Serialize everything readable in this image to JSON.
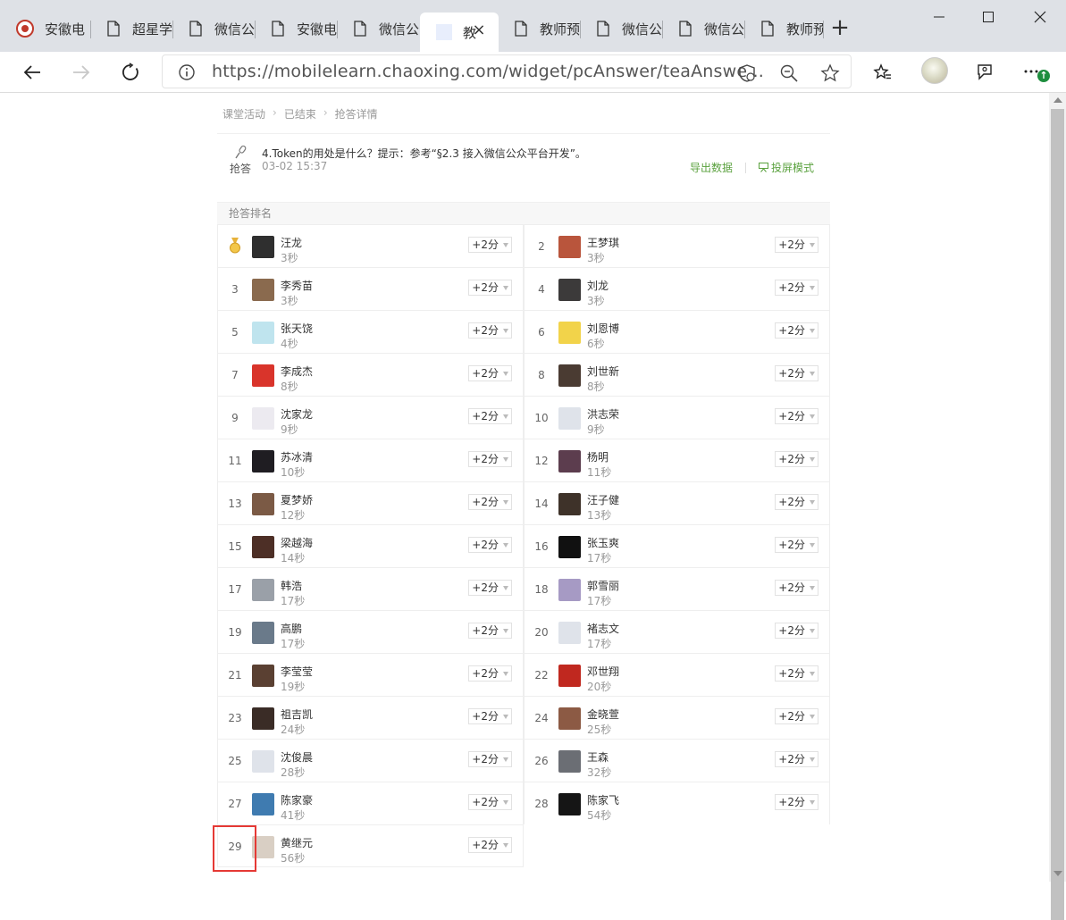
{
  "browser": {
    "tabs": [
      {
        "title": "安徽电",
        "icon": "seal-icon",
        "left": 0
      },
      {
        "title": "超星学",
        "icon": "page-icon"
      },
      {
        "title": "微信公",
        "icon": "page-icon"
      },
      {
        "title": "安徽电",
        "icon": "page-icon"
      },
      {
        "title": "微信公",
        "icon": "page-icon"
      },
      {
        "title": "教",
        "icon": "blank-icon",
        "active": true
      },
      {
        "title": "教师预",
        "icon": "page-icon"
      },
      {
        "title": "微信公",
        "icon": "page-icon"
      },
      {
        "title": "微信公",
        "icon": "page-icon"
      },
      {
        "title": "教师预",
        "icon": "page-icon"
      }
    ],
    "url": "https://mobilelearn.chaoxing.com/widget/pcAnswer/teaAnswe..."
  },
  "breadcrumb": [
    "课堂活动",
    "已结束",
    "抢答详情"
  ],
  "question": {
    "type_label": "抢答",
    "title": "4.Token的用处是什么？提示：参考“§2.3 接入微信公众平台开发”。",
    "time": "03-02 15:37",
    "export_label": "导出数据",
    "projector_label": "投屏模式"
  },
  "ranking": {
    "header": "抢答排名",
    "score_label": "+2分",
    "rows": [
      {
        "rank": "1",
        "name": "汪龙",
        "time": "3秒",
        "avatar": "#2f2f2f"
      },
      {
        "rank": "2",
        "name": "王梦琪",
        "time": "3秒",
        "avatar": "#b9553c"
      },
      {
        "rank": "3",
        "name": "李秀苗",
        "time": "3秒",
        "avatar": "#8a6a4e"
      },
      {
        "rank": "4",
        "name": "刘龙",
        "time": "3秒",
        "avatar": "#3c3a3a"
      },
      {
        "rank": "5",
        "name": "张天饶",
        "time": "4秒",
        "avatar": "#bfe4ee"
      },
      {
        "rank": "6",
        "name": "刘恩博",
        "time": "6秒",
        "avatar": "#f2d34a"
      },
      {
        "rank": "7",
        "name": "李成杰",
        "time": "8秒",
        "avatar": "#d9342b"
      },
      {
        "rank": "8",
        "name": "刘世新",
        "time": "8秒",
        "avatar": "#4a3b32"
      },
      {
        "rank": "9",
        "name": "沈家龙",
        "time": "9秒",
        "avatar": "#eceaf0"
      },
      {
        "rank": "10",
        "name": "洪志荣",
        "time": "9秒",
        "avatar": "#dfe3ea"
      },
      {
        "rank": "11",
        "name": "苏冰清",
        "time": "10秒",
        "avatar": "#1f1d22"
      },
      {
        "rank": "12",
        "name": "杨明",
        "time": "11秒",
        "avatar": "#5c3d4e"
      },
      {
        "rank": "13",
        "name": "夏梦娇",
        "time": "12秒",
        "avatar": "#7b5a45"
      },
      {
        "rank": "14",
        "name": "汪子健",
        "time": "13秒",
        "avatar": "#3e3229"
      },
      {
        "rank": "15",
        "name": "梁越海",
        "time": "14秒",
        "avatar": "#4d2f26"
      },
      {
        "rank": "16",
        "name": "张玉爽",
        "time": "17秒",
        "avatar": "#111111"
      },
      {
        "rank": "17",
        "name": "韩浩",
        "time": "17秒",
        "avatar": "#9aa0a8"
      },
      {
        "rank": "18",
        "name": "郭雪丽",
        "time": "17秒",
        "avatar": "#a69ac4"
      },
      {
        "rank": "19",
        "name": "高鹏",
        "time": "17秒",
        "avatar": "#6a7a8a"
      },
      {
        "rank": "20",
        "name": "褚志文",
        "time": "17秒",
        "avatar": "#dfe3ea"
      },
      {
        "rank": "21",
        "name": "李莹莹",
        "time": "19秒",
        "avatar": "#5a4032"
      },
      {
        "rank": "22",
        "name": "邓世翔",
        "time": "20秒",
        "avatar": "#c0281f"
      },
      {
        "rank": "23",
        "name": "祖吉凯",
        "time": "24秒",
        "avatar": "#3a2c26"
      },
      {
        "rank": "24",
        "name": "金晓萱",
        "time": "25秒",
        "avatar": "#8c5a44"
      },
      {
        "rank": "25",
        "name": "沈俊晨",
        "time": "28秒",
        "avatar": "#dfe3ea"
      },
      {
        "rank": "26",
        "name": "王森",
        "time": "32秒",
        "avatar": "#6b6e74"
      },
      {
        "rank": "27",
        "name": "陈家豪",
        "time": "41秒",
        "avatar": "#3f7bb0"
      },
      {
        "rank": "28",
        "name": "陈家飞",
        "time": "54秒",
        "avatar": "#151515"
      },
      {
        "rank": "29",
        "name": "黄继元",
        "time": "56秒",
        "avatar": "#d9cfc4"
      }
    ]
  },
  "colors": {
    "accent_green": "#5aa13e",
    "highlight_red": "#e53935"
  }
}
